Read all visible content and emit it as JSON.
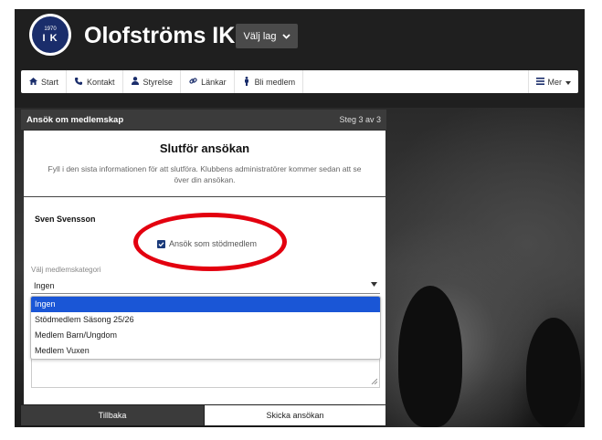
{
  "brand": {
    "club_name": "Olofströms IK",
    "logo_year": "1970",
    "logo_letters": "I K",
    "team_select_label": "Välj lag",
    "team_select_icon": "chevron-down-icon"
  },
  "nav": {
    "items": [
      {
        "label": "Start",
        "icon": "home-icon"
      },
      {
        "label": "Kontakt",
        "icon": "phone-icon"
      },
      {
        "label": "Styrelse",
        "icon": "user-icon"
      },
      {
        "label": "Länkar",
        "icon": "link-icon"
      },
      {
        "label": "Bli medlem",
        "icon": "person-icon"
      }
    ],
    "more_label": "Mer"
  },
  "panel": {
    "title": "Ansök om medlemskap",
    "step": "Steg 3 av 3"
  },
  "form": {
    "heading": "Slutför ansökan",
    "description": "Fyll i den sista informationen för att slutföra. Klubbens administratörer kommer sedan att se över din ansökan.",
    "member_name": "Sven Svensson",
    "support_label": "Ansök som stödmedlem",
    "support_checked": true,
    "category_label": "Välj medlemskategori",
    "category_value": "Ingen",
    "category_options": [
      "Ingen",
      "Stödmedlem Säsong 25/26",
      "Medlem Barn/Ungdom",
      "Medlem Vuxen"
    ]
  },
  "buttons": {
    "back": "Tillbaka",
    "submit": "Skicka ansökan"
  },
  "colors": {
    "brand_navy": "#1a2d6b",
    "highlight": "#1a56d6",
    "annotation_red": "#e3000f",
    "dark_header": "#3b3b3b"
  }
}
